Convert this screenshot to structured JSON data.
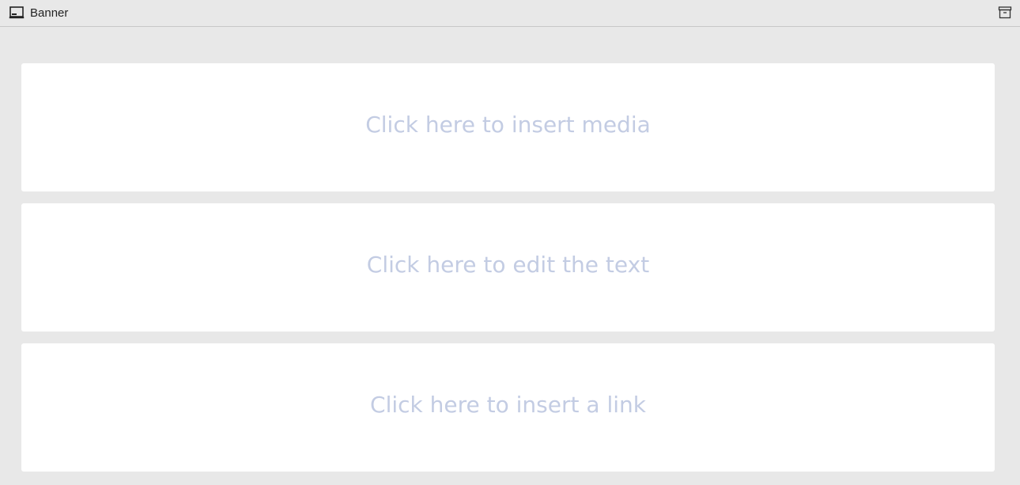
{
  "header": {
    "title": "Banner",
    "icon": "banner-icon",
    "action_icon": "archive-icon"
  },
  "cards": {
    "media": {
      "label": "Click here to insert media"
    },
    "text": {
      "label": "Click here to edit the text"
    },
    "link": {
      "label": "Click here to insert a link"
    }
  },
  "colors": {
    "background": "#e8e8e8",
    "card": "#ffffff",
    "placeholder_text": "#c3cce3",
    "header_text": "#222222"
  }
}
